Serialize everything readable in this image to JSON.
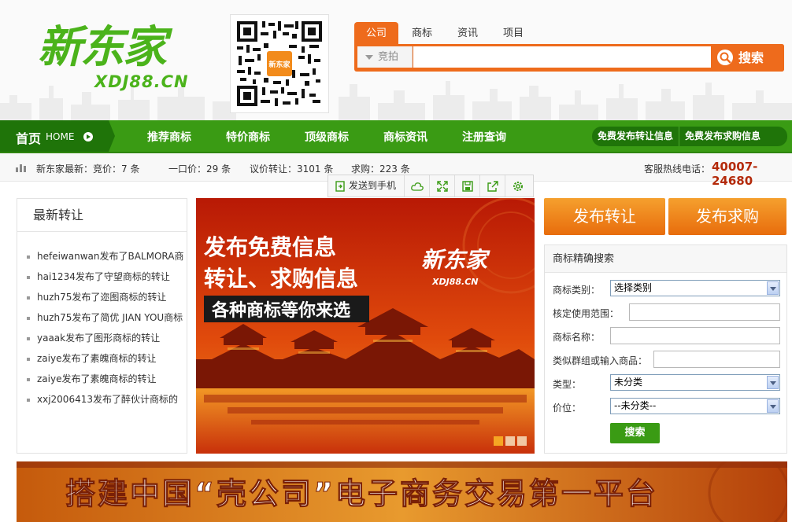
{
  "header": {
    "logo_cn": "新东家",
    "logo_en": "XDJ88.CN",
    "qr_label": "新东家",
    "search": {
      "tabs": [
        "公司",
        "商标",
        "资讯",
        "项目"
      ],
      "active_tab": 0,
      "select_value": "竞拍",
      "input_placeholder": "",
      "button_label": "搜索"
    }
  },
  "nav": {
    "home_cn": "首页",
    "home_en": "HOME",
    "items": [
      "推荐商标",
      "特价商标",
      "顶级商标",
      "商标资讯",
      "注册查询"
    ],
    "right_buttons": [
      "免费发布转让信息",
      "免费发布求购信息"
    ]
  },
  "stats": {
    "site": "新东家最新：竞价：7 条",
    "fixed": "一口价：29 条",
    "negotiate": "议价转让：3101 条",
    "wanted": "求购：223 条",
    "hotline_label": "客服热线电话：",
    "hotline": "40007-24680"
  },
  "toolbar": {
    "send_label": "发送到手机",
    "icons": [
      "cloud-icon",
      "expand-icon",
      "save-icon",
      "share-icon",
      "settings-icon"
    ]
  },
  "left": {
    "title": "最新转让",
    "items": [
      "hefeiwanwan发布了BALMORA商",
      "hai1234发布了守望商标的转让",
      "huzh75发布了迩图商标的转让",
      "huzh75发布了简优 JIAN YOU商标",
      "yaaak发布了图形商标的转让",
      "zaiye发布了素魄商标的转让",
      "zaiye发布了素魄商标的转让",
      "xxj2006413发布了醉伙计商标的"
    ]
  },
  "banner": {
    "line1": "发布免费信息",
    "line2": "转让、求购信息",
    "line3": "各种商标等你来选",
    "brand_cn": "新东家",
    "brand_en": "XDJ88.CN",
    "slide_count": 3,
    "active_slide": 0
  },
  "right": {
    "pub_sell": "发布转让",
    "pub_buy": "发布求购",
    "form_title": "商标精确搜索",
    "category_label": "商标类别：",
    "category_value": "选择类别",
    "scope_label": "核定使用范围：",
    "name_label": "商标名称：",
    "group_label": "类似群组或输入商品：",
    "type_label": "类型：",
    "type_value": "未分类",
    "price_label": "价位：",
    "price_value": "--未分类--",
    "submit": "搜索"
  },
  "bottom_banner": {
    "text": "搭建中国“壳公司”电子商务交易第一平台"
  },
  "colors": {
    "brand_green": "#4bb31b",
    "nav_green": "#3a9b14",
    "accent_orange": "#ee6b1c",
    "hotline_red": "#b42a0a"
  }
}
